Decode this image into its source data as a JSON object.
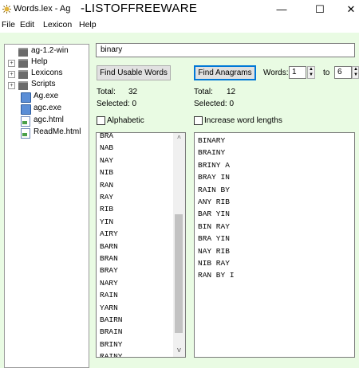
{
  "window": {
    "title": "Words.lex - Ag",
    "title_banner": "-LISTOFFREEWARE",
    "controls": {
      "minimize": "—",
      "maximize": "☐",
      "close": "✕"
    }
  },
  "menu": [
    "File",
    "Edit",
    "Lexicon",
    "Help"
  ],
  "tree": {
    "root": "ag-1.2-win",
    "folders": [
      "Help",
      "Lexicons",
      "Scripts"
    ],
    "files": [
      "Ag.exe",
      "agc.exe",
      "agc.html",
      "ReadMe.html"
    ]
  },
  "search": {
    "value": "binary"
  },
  "usable": {
    "button": "Find Usable Words",
    "total_label": "Total:",
    "total_value": "32",
    "selected_text": "Selected: 0",
    "checkbox_label": "Alphabetic",
    "words": [
      "BRA",
      "NAB",
      "NAY",
      "NIB",
      "RAN",
      "RAY",
      "RIB",
      "YIN",
      "AIRY",
      "BARN",
      "BRAN",
      "BRAY",
      "NARY",
      "RAIN",
      "YARN",
      "BAIRN",
      "BRAIN",
      "BRINY",
      "RAINY"
    ]
  },
  "anagrams": {
    "button": "Find Anagrams",
    "words_label": "Words:",
    "words_from": "1",
    "to_label": "to",
    "words_to": "6",
    "total_label": "Total:",
    "total_value": "12",
    "selected_text": "Selected: 0",
    "checkbox_label": "Increase word lengths",
    "results": [
      "BINARY",
      "BRAINY",
      "BRINY A",
      "BRAY IN",
      "RAIN BY",
      "ANY RIB",
      "BAR YIN",
      "BIN RAY",
      "BRA YIN",
      "NAY RIB",
      "NIB RAY",
      "RAN BY I"
    ]
  },
  "colors": {
    "client_bg": "#e9fbe3",
    "focus_border": "#0078d7"
  }
}
